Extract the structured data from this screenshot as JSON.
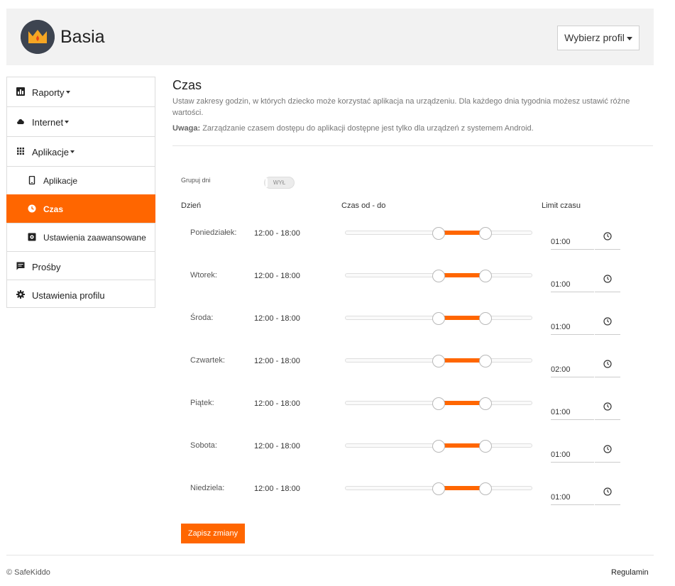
{
  "header": {
    "profile_name": "Basia",
    "profile_button_label": "Wybierz profil"
  },
  "sidebar": {
    "items": [
      {
        "label": "Raporty",
        "icon": "bar-chart-icon"
      },
      {
        "label": "Internet",
        "icon": "cloud-icon"
      },
      {
        "label": "Aplikacje",
        "icon": "grid-icon"
      },
      {
        "label": "Aplikacje",
        "icon": "phone-icon"
      },
      {
        "label": "Czas",
        "icon": "clock-icon",
        "active": true
      },
      {
        "label": "Ustawienia zaawansowane",
        "icon": "settings-box-icon"
      },
      {
        "label": "Prośby",
        "icon": "message-icon"
      },
      {
        "label": "Ustawienia profilu",
        "icon": "gear-icon"
      }
    ]
  },
  "main": {
    "title": "Czas",
    "description": "Ustaw zakresy godzin, w których dziecko może korzystać aplikacja na urządzeniu. Dla każdego dnia tygodnia możesz ustawić różne wartości.",
    "note_label": "Uwaga:",
    "note_text": "Zarządzanie czasem dostępu do aplikacji dostępne jest tylko dla urządzeń z systemem Android.",
    "group_days_label": "Grupuj dni",
    "group_days_toggle": "WYŁ",
    "columns": {
      "day": "Dzień",
      "range": "Czas od - do",
      "limit": "Limit czasu"
    },
    "slider_scale_hours": 24,
    "days": [
      {
        "name": "Poniedziałek:",
        "range": "12:00 - 18:00",
        "from_hour": 12,
        "to_hour": 18,
        "limit": "01:00"
      },
      {
        "name": "Wtorek:",
        "range": "12:00 - 18:00",
        "from_hour": 12,
        "to_hour": 18,
        "limit": "01:00"
      },
      {
        "name": "Środa:",
        "range": "12:00 - 18:00",
        "from_hour": 12,
        "to_hour": 18,
        "limit": "01:00"
      },
      {
        "name": "Czwartek:",
        "range": "12:00 - 18:00",
        "from_hour": 12,
        "to_hour": 18,
        "limit": "02:00"
      },
      {
        "name": "Piątek:",
        "range": "12:00 - 18:00",
        "from_hour": 12,
        "to_hour": 18,
        "limit": "01:00"
      },
      {
        "name": "Sobota:",
        "range": "12:00 - 18:00",
        "from_hour": 12,
        "to_hour": 18,
        "limit": "01:00"
      },
      {
        "name": "Niedziela:",
        "range": "12:00 - 18:00",
        "from_hour": 12,
        "to_hour": 18,
        "limit": "01:00"
      }
    ],
    "save_label": "Zapisz zmiany"
  },
  "footer": {
    "copyright": "© SafeKiddo",
    "terms": "Regulamin"
  },
  "colors": {
    "accent": "#ff6600",
    "header_bg": "#f2f2f2"
  }
}
